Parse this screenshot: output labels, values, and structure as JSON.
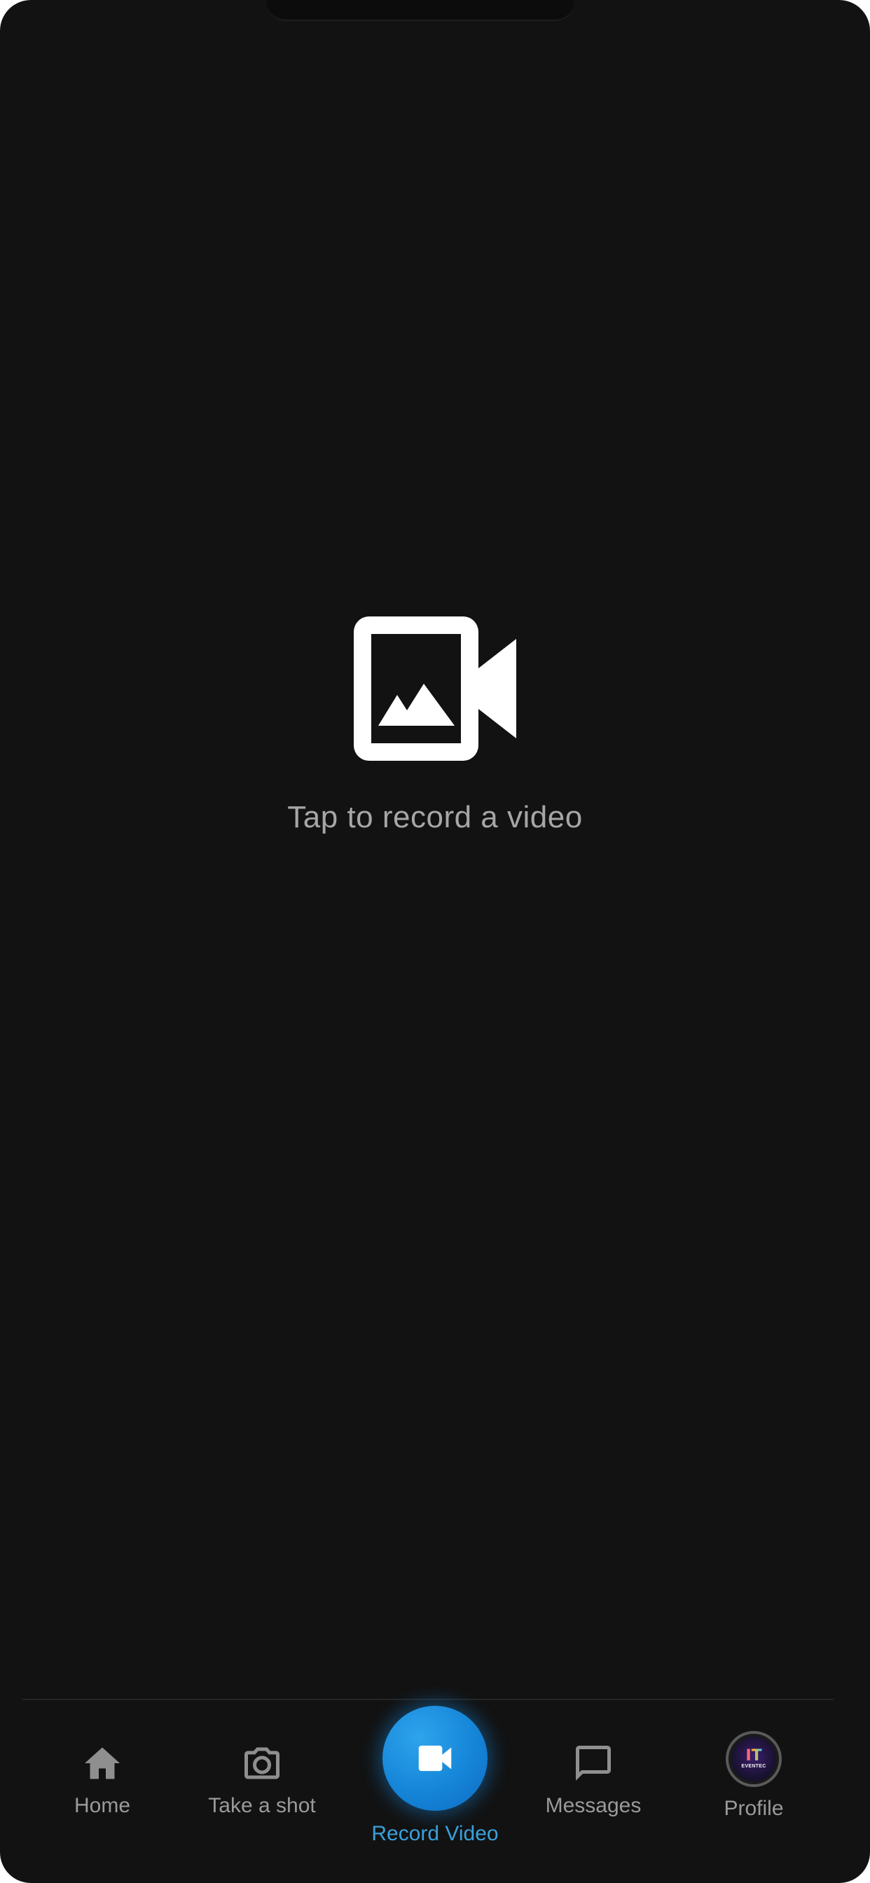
{
  "empty_state": {
    "icon": "video-library-icon",
    "text": "Tap to record a video"
  },
  "tab_bar": {
    "active_color": "#3aa0dc",
    "inactive_color": "#9a9a9a",
    "tabs": [
      {
        "id": "home",
        "icon": "home-icon",
        "label": "Home",
        "active": false
      },
      {
        "id": "take-a-shot",
        "icon": "camera-icon",
        "label": "Take a shot",
        "active": false
      },
      {
        "id": "record-video",
        "icon": "videocam-icon",
        "label": "Record Video",
        "active": true
      },
      {
        "id": "messages",
        "icon": "chat-bubble-icon",
        "label": "Messages",
        "active": false
      },
      {
        "id": "profile",
        "icon": "avatar",
        "label": "Profile",
        "active": false
      }
    ],
    "profile_avatar": {
      "mark": "IT",
      "text": "EVENTEC"
    }
  }
}
